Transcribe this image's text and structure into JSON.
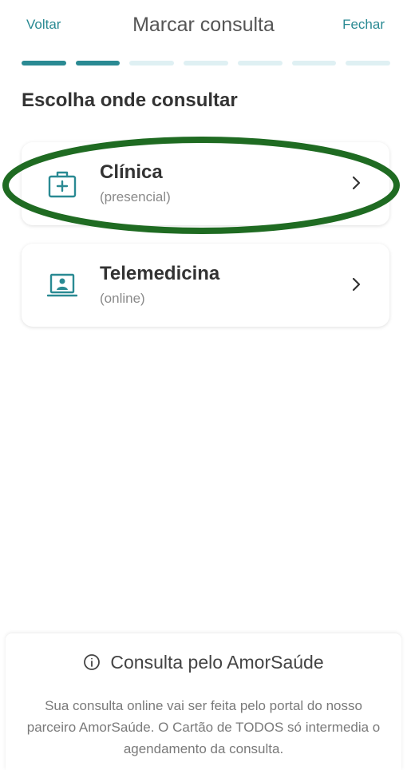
{
  "header": {
    "back_label": "Voltar",
    "title": "Marcar consulta",
    "close_label": "Fechar"
  },
  "progress": {
    "current_step": 2,
    "total_steps": 7
  },
  "section_title": "Escolha onde consultar",
  "options": [
    {
      "label": "Clínica",
      "sublabel": "(presencial)",
      "icon": "medical-kit-icon",
      "highlighted": true
    },
    {
      "label": "Telemedicina",
      "sublabel": "(online)",
      "icon": "laptop-doctor-icon",
      "highlighted": false
    }
  ],
  "footer": {
    "title": "Consulta pelo AmorSaúde",
    "icon": "info-icon",
    "body": "Sua consulta online vai ser feita pelo portal do nosso parceiro AmorSaúde. O Cartão de TODOS só intermedia o agendamento da consulta."
  },
  "colors": {
    "accent": "#2a8a93",
    "progress_inactive": "#dff0f3",
    "highlight_ring": "#1f6b22"
  }
}
